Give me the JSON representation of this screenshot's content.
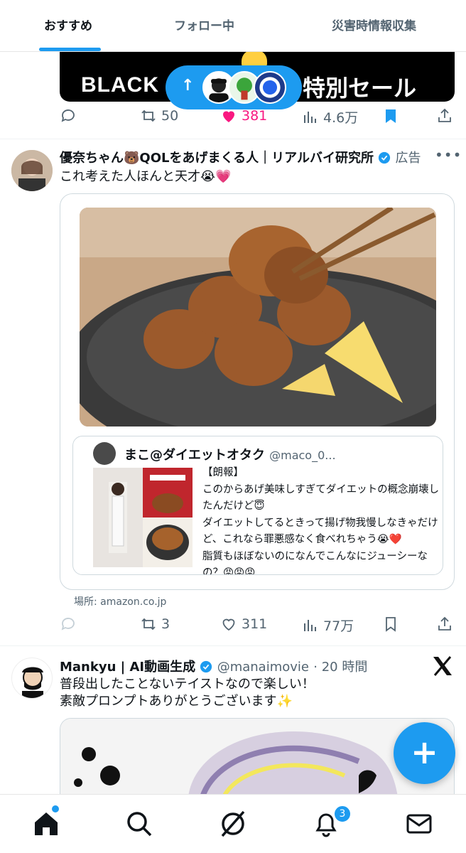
{
  "tabs": [
    {
      "label": "おすすめ",
      "active": true
    },
    {
      "label": "フォロー中",
      "active": false
    },
    {
      "label": "災害時情報収集",
      "active": false
    }
  ],
  "top_banner": {
    "left_text": "BLACK",
    "right_text": "特別セール"
  },
  "new_posts_pill": {
    "arrow": "↑",
    "avatars": [
      "person-with-cap",
      "green-character",
      "blue-crest"
    ]
  },
  "post_top_actions": {
    "reposts": "50",
    "likes": "381",
    "views": "4.6万",
    "liked": true,
    "bookmarked": true
  },
  "ad_post": {
    "author": "優奈ちゃん🐻QOLをあげまくる人｜リアルバイ研究所",
    "label": "広告",
    "text": "これ考えた人ほんと天才😭💗",
    "quote": {
      "author": "まこ@ダイエットオタク",
      "handle": "@maco_0...",
      "text": "【朗報】\nこのからあげ美味しすぎてダイエットの概念崩壊したんだけど😇\nダイエットしてるときって揚げ物我慢しなきゃだけど、これなら罪悪感なく食べれちゃう😭❤️\n脂質もほぼないのになんでこんなにジューシーなの？😡😡😡\n作った人にノーベル賞与えてください🥹🤍🤍..."
    },
    "source": "場所: amazon.co.jp",
    "actions": {
      "reposts": "3",
      "likes": "311",
      "views": "77万"
    }
  },
  "third_post": {
    "author": "Mankyu | AI動画生成",
    "handle": "@manaimovie",
    "time": "· 20 時間",
    "text_line1": "普段出したことないテイストなので楽しい！",
    "text_line2": "素敵プロンプトありがとうございます✨"
  },
  "fab": {
    "label": "+"
  },
  "bottom_nav": {
    "notification_count": "3"
  },
  "colors": {
    "accent": "#1d9bf0",
    "like": "#f91880",
    "text": "#0f1419",
    "muted": "#536471"
  }
}
